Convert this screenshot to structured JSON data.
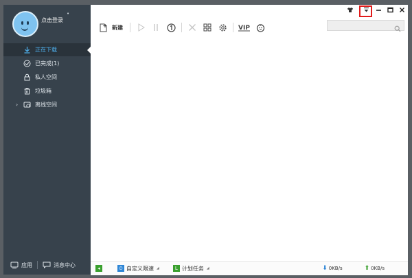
{
  "user": {
    "login_label": "点击登录",
    "login_marker": "•"
  },
  "sidebar": {
    "items": [
      {
        "label": "正在下载",
        "icon": "download-arrow-icon",
        "active": true
      },
      {
        "label": "已完成(1)",
        "icon": "check-circle-icon",
        "active": false
      },
      {
        "label": "私人空间",
        "icon": "lock-icon",
        "active": false
      },
      {
        "label": "垃圾箱",
        "icon": "trash-icon",
        "active": false
      },
      {
        "label": "离线空间",
        "icon": "cloud-icon",
        "active": false,
        "expandable": true
      }
    ],
    "expand_glyph": "›",
    "bottom": {
      "apps_label": "应用",
      "messages_label": "消息中心"
    }
  },
  "toolbar": {
    "new_label": "新建",
    "vip_label": "VIP"
  },
  "search": {
    "placeholder": ""
  },
  "statusbar": {
    "custom_speed_label": "自定义限速",
    "schedule_label": "计划任务",
    "download_speed": "0KB/s",
    "upload_speed": "0KB/s",
    "caret": "◢"
  },
  "colors": {
    "sidebar_bg": "#37424c",
    "accent": "#4fb2f0",
    "highlight": "#e21b1b"
  }
}
